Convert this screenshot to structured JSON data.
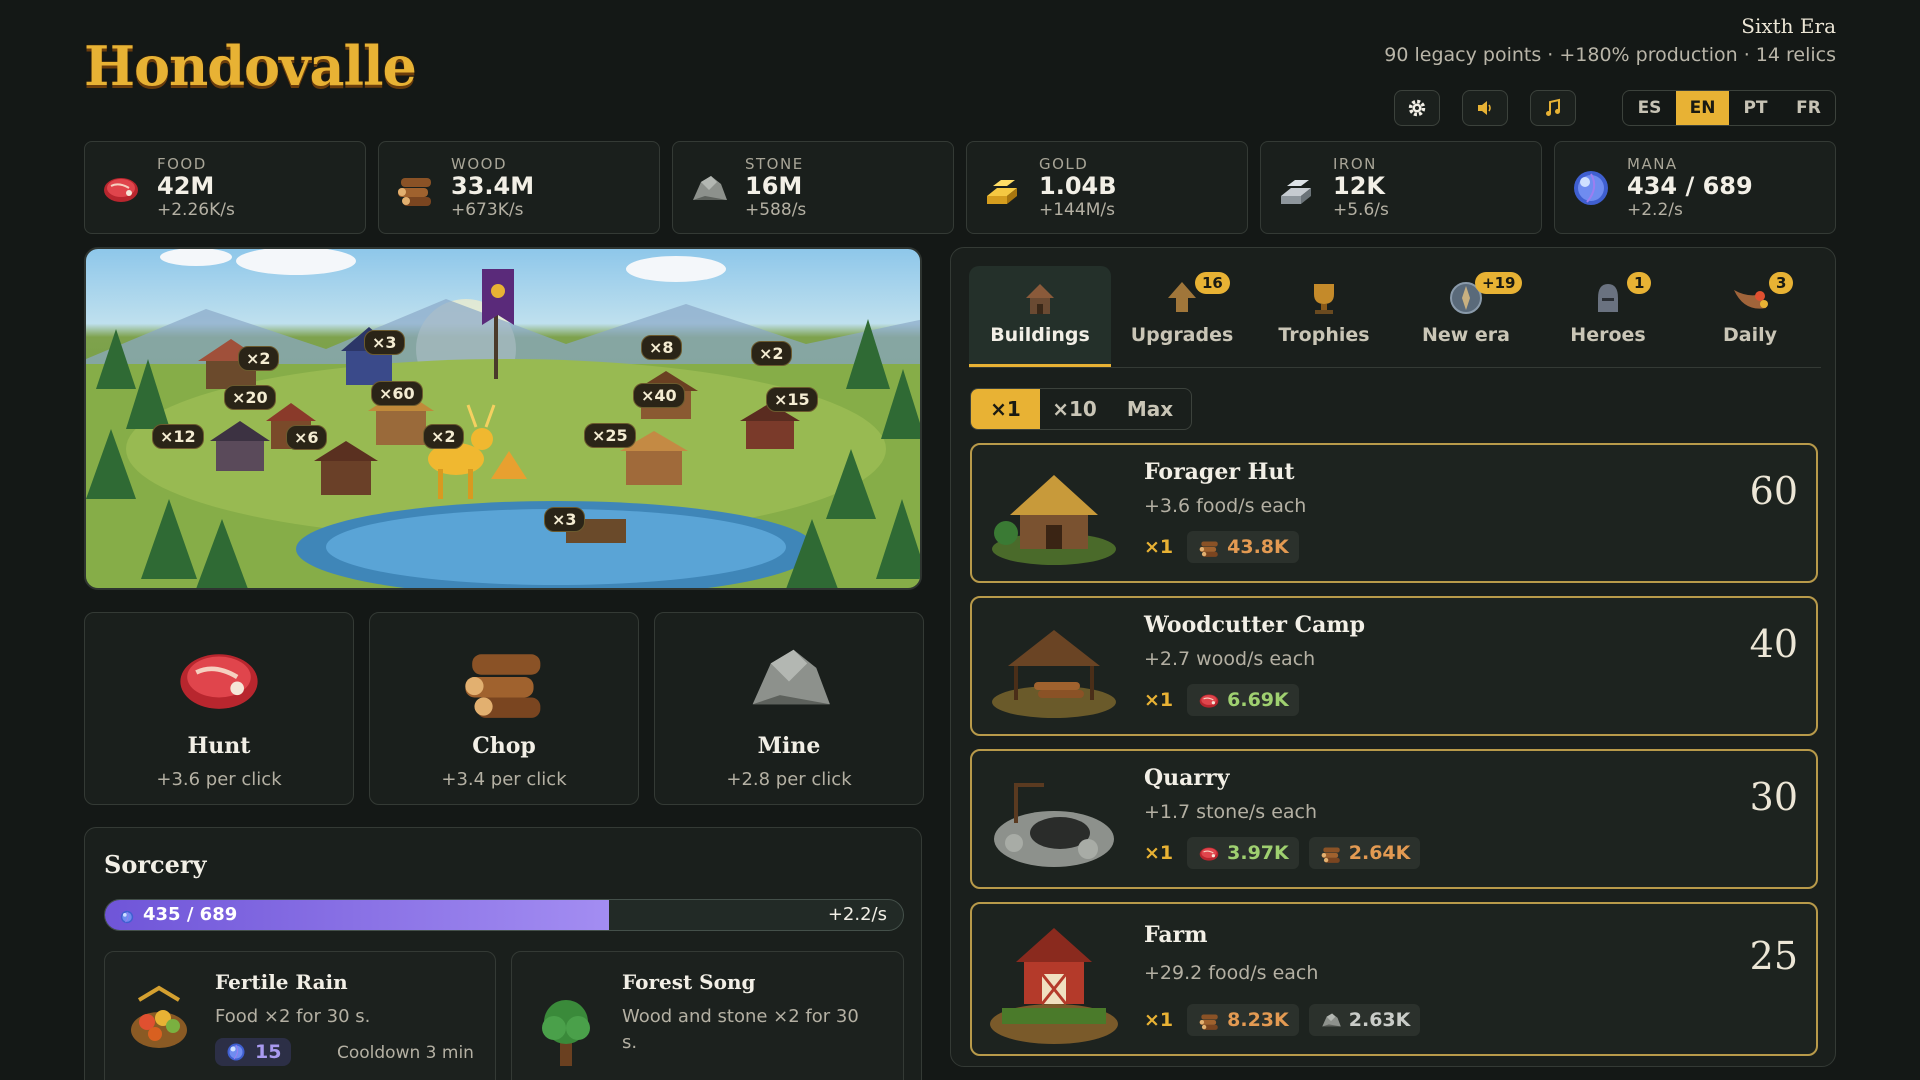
{
  "header": {
    "title": "Hondovalle",
    "era": "Sixth Era",
    "era_stats": "90 legacy points · +180% production · 14 relics"
  },
  "toolbar": {
    "settings_icon": "gear-icon",
    "sound_icon": "speaker-icon",
    "music_icon": "music-note-icon",
    "languages": [
      "ES",
      "EN",
      "PT",
      "FR"
    ],
    "active_language": "EN"
  },
  "resources": [
    {
      "name": "FOOD",
      "value": "42M",
      "rate": "+2.26K/s",
      "icon": "meat-icon"
    },
    {
      "name": "WOOD",
      "value": "33.4M",
      "rate": "+673K/s",
      "icon": "logs-icon"
    },
    {
      "name": "STONE",
      "value": "16M",
      "rate": "+588/s",
      "icon": "stone-icon"
    },
    {
      "name": "GOLD",
      "value": "1.04B",
      "rate": "+144M/s",
      "icon": "gold-icon"
    },
    {
      "name": "IRON",
      "value": "12K",
      "rate": "+5.6/s",
      "icon": "iron-icon"
    },
    {
      "name": "MANA",
      "value": "434 / 689",
      "rate": "+2.2/s",
      "icon": "mana-orb-icon"
    }
  ],
  "map": {
    "counts": [
      "×2",
      "×3",
      "×8",
      "×2",
      "×20",
      "×60",
      "×40",
      "×15",
      "×12",
      "×6",
      "×2",
      "×25",
      "×3"
    ]
  },
  "actions": [
    {
      "name": "Hunt",
      "rate": "+3.6 per click",
      "icon": "meat-icon"
    },
    {
      "name": "Chop",
      "rate": "+3.4 per click",
      "icon": "logs-icon"
    },
    {
      "name": "Mine",
      "rate": "+2.8 per click",
      "icon": "stone-icon"
    }
  ],
  "sorcery": {
    "title": "Sorcery",
    "mana_label": "435 / 689",
    "mana_fraction": 0.631,
    "mana_rate": "+2.2/s",
    "spells": [
      {
        "name": "Fertile Rain",
        "desc": "Food ×2 for 30 s.",
        "cost": "15",
        "cooldown": "Cooldown 3 min"
      },
      {
        "name": "Forest Song",
        "desc_1": "Wood and stone ×2 for 30",
        "desc_2": "s."
      }
    ]
  },
  "tabs": [
    {
      "label": "Buildings",
      "badge": ""
    },
    {
      "label": "Upgrades",
      "badge": "16"
    },
    {
      "label": "Trophies",
      "badge": ""
    },
    {
      "label": "New era",
      "badge": "+19"
    },
    {
      "label": "Heroes",
      "badge": "1"
    },
    {
      "label": "Daily",
      "badge": "3"
    }
  ],
  "quantity": {
    "options": [
      "×1",
      "×10",
      "Max"
    ],
    "active": "×1"
  },
  "buildings": [
    {
      "name": "Forager Hut",
      "desc": "+3.6 food/s each",
      "count": "60",
      "mult": "×1",
      "costs": [
        {
          "type": "wood",
          "value": "43.8K"
        }
      ]
    },
    {
      "name": "Woodcutter Camp",
      "desc": "+2.7 wood/s each",
      "count": "40",
      "mult": "×1",
      "costs": [
        {
          "type": "food",
          "value": "6.69K"
        }
      ]
    },
    {
      "name": "Quarry",
      "desc": "+1.7 stone/s each",
      "count": "30",
      "mult": "×1",
      "costs": [
        {
          "type": "food",
          "value": "3.97K"
        },
        {
          "type": "wood",
          "value": "2.64K"
        }
      ]
    },
    {
      "name": "Farm",
      "desc": "+29.2 food/s each",
      "count": "25",
      "mult": "×1",
      "costs": [
        {
          "type": "wood",
          "value": "8.23K"
        },
        {
          "type": "stone",
          "value": "2.63K"
        }
      ]
    }
  ],
  "colors": {
    "accent": "#e8b234",
    "background": "#141816",
    "card": "#1a1f1c",
    "mana": "#8a73e6"
  }
}
